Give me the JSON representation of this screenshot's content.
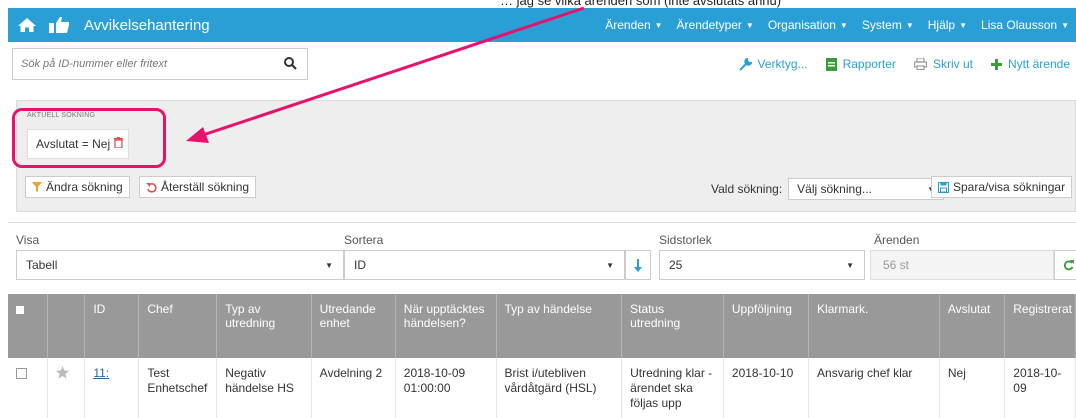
{
  "caption": "… jag se vilka ärenden som (inte avslutats ännu)",
  "navbar": {
    "title": "Avvikelsehantering",
    "menu": [
      "Ärenden",
      "Ärendetyper",
      "Organisation",
      "System",
      "Hjälp",
      "Lisa Olausson"
    ]
  },
  "search": {
    "placeholder": "Sök på ID-nummer eller fritext"
  },
  "actions": {
    "tools": "Verktyg...",
    "reports": "Rapporter",
    "print": "Skriv ut",
    "new": "Nytt ärende"
  },
  "panel": {
    "label": "AKTUELL SÖKNING",
    "chip": "Avslutat = Nej",
    "change": "Ändra sökning",
    "reset": "Återställ sökning",
    "chosen_label": "Vald sökning:",
    "chosen_value": "Välj sökning...",
    "save": "Spara/visa sökningar"
  },
  "options": {
    "view_label": "Visa",
    "view_value": "Tabell",
    "sort_label": "Sortera",
    "sort_value": "ID",
    "size_label": "Sidstorlek",
    "size_value": "25",
    "count_label": "Ärenden",
    "count_value": "56 st"
  },
  "table": {
    "headers": [
      "ID",
      "Chef",
      "Typ av utredning",
      "Utredande enhet",
      "När upptäcktes händelsen?",
      "Typ av händelse",
      "Status utredning",
      "Uppföljning",
      "Klarmark.",
      "Avslutat",
      "Registrerat"
    ],
    "rows": [
      {
        "id": "11:",
        "chef": "Test Enhetschef",
        "typ": "Negativ händelse HS",
        "enhet": "Avdelning 2",
        "nar": "2018-10-09 01:00:00",
        "handelse": "Brist i/utebliven vårdåtgärd (HSL)",
        "status": "Utredning klar - ärendet ska följas upp",
        "uppfoljning": "2018-10-10",
        "klarmark": "Ansvarig chef klar",
        "avslutat": "Nej",
        "registrerat": "2018-10-09"
      }
    ]
  },
  "colors": {
    "brand": "#2a9fd6",
    "highlight": "#e8116b",
    "header": "#999999"
  }
}
